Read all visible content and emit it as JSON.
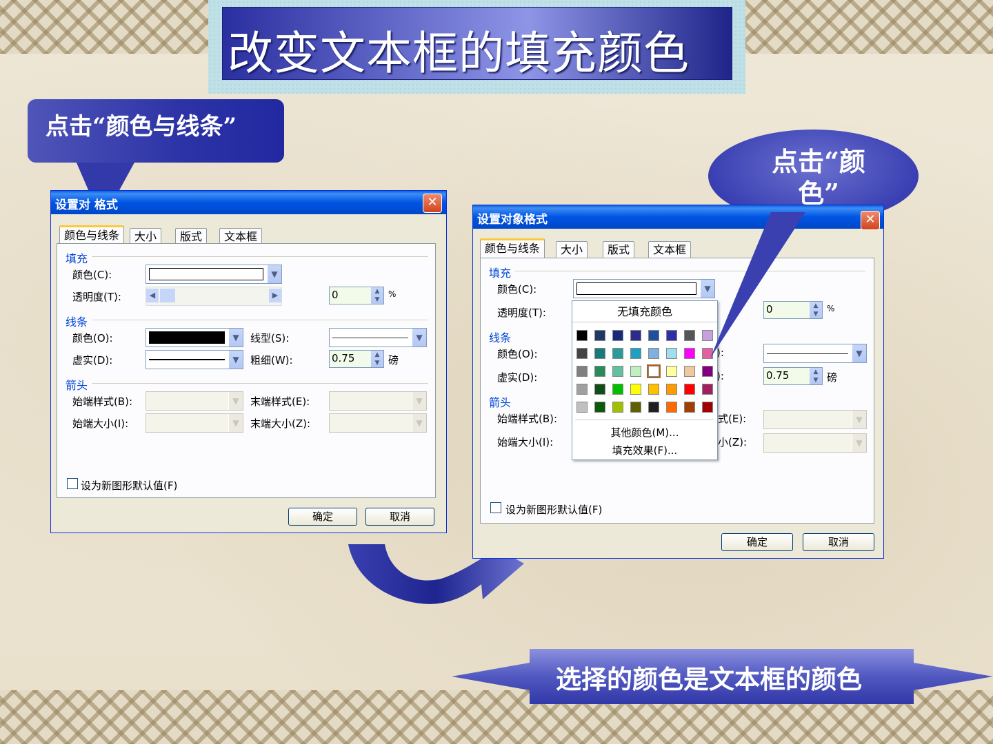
{
  "title": "改变文本框的填充颜色",
  "callout_left": "点击“颜色与线条”",
  "callout_right": "点击“颜色”",
  "bottom_banner": "选择的颜色是文本框的颜色",
  "dialog_left": {
    "title": "设置对 格式",
    "tabs": [
      "颜色与线条",
      "大小",
      "版式",
      "文本框"
    ],
    "fill_section": "填充",
    "fill_color_label": "颜色(C):",
    "transparency_label": "透明度(T):",
    "transparency_value": "0",
    "percent": "%",
    "line_section": "线条",
    "line_color_label": "颜色(O):",
    "dashed_label": "虚实(D):",
    "line_style_label": "线型(S):",
    "weight_label": "粗细(W):",
    "weight_value": "0.75",
    "weight_unit": "磅",
    "arrow_section": "箭头",
    "begin_style_label": "始端样式(B):",
    "end_style_label": "末端样式(E):",
    "begin_size_label": "始端大小(I):",
    "end_size_label": "末端大小(Z):",
    "default_checkbox": "设为新图形默认值(F)",
    "ok": "确定",
    "cancel": "取消"
  },
  "dialog_right": {
    "title": "设置对象格式",
    "tabs": [
      "颜色与线条",
      "大小",
      "版式",
      "文本框"
    ],
    "fill_section": "填充",
    "fill_color_label": "颜色(C):",
    "transparency_label": "透明度(T):",
    "transparency_value": "0",
    "percent": "%",
    "line_section": "线条",
    "line_color_label": "颜色(O):",
    "dashed_label": "虚实(D):",
    "line_style_partial": "):",
    "weight_partial": "):",
    "weight_value": "0.75",
    "weight_unit": "磅",
    "arrow_section": "箭头",
    "begin_style_label": "始端样式(B):",
    "end_style_partial": "式(E):",
    "begin_size_label": "始端大小(I):",
    "end_size_partial": "小(Z):",
    "default_checkbox": "设为新图形默认值(F)",
    "ok": "确定",
    "cancel": "取消",
    "palette": {
      "no_fill": "无填充颜色",
      "more_colors": "其他颜色(M)...",
      "fill_effects": "填充效果(F)...",
      "colors": [
        [
          "#000000",
          "#1f3864",
          "#1a2a7a",
          "#2c2c8a",
          "#1f4fa0",
          "#2e2ea8",
          "#555555",
          "#c8a0e0"
        ],
        [
          "#444444",
          "#1a7a7a",
          "#2a9a9a",
          "#20a0c0",
          "#7fb0e0",
          "#9ee0f0",
          "#ff00ff",
          "#e060a0"
        ],
        [
          "#808080",
          "#2a8a5a",
          "#60c0a0",
          "#c0f0c0",
          "#ffffff",
          "#ffffa0",
          "#f0c8a0",
          "#800080"
        ],
        [
          "#a0a0a0",
          "#114d1a",
          "#00c000",
          "#ffff00",
          "#ffc000",
          "#ff9a00",
          "#ff0000",
          "#a02060"
        ],
        [
          "#c0c0c0",
          "#0a5a0a",
          "#a0c000",
          "#606000",
          "#202020",
          "#ff6a00",
          "#a04000",
          "#a00000"
        ]
      ]
    }
  },
  "colors": {
    "accent_blue": "#2c33a6",
    "xp_title": "#0054e3",
    "dialog_bg": "#ece9d8"
  }
}
